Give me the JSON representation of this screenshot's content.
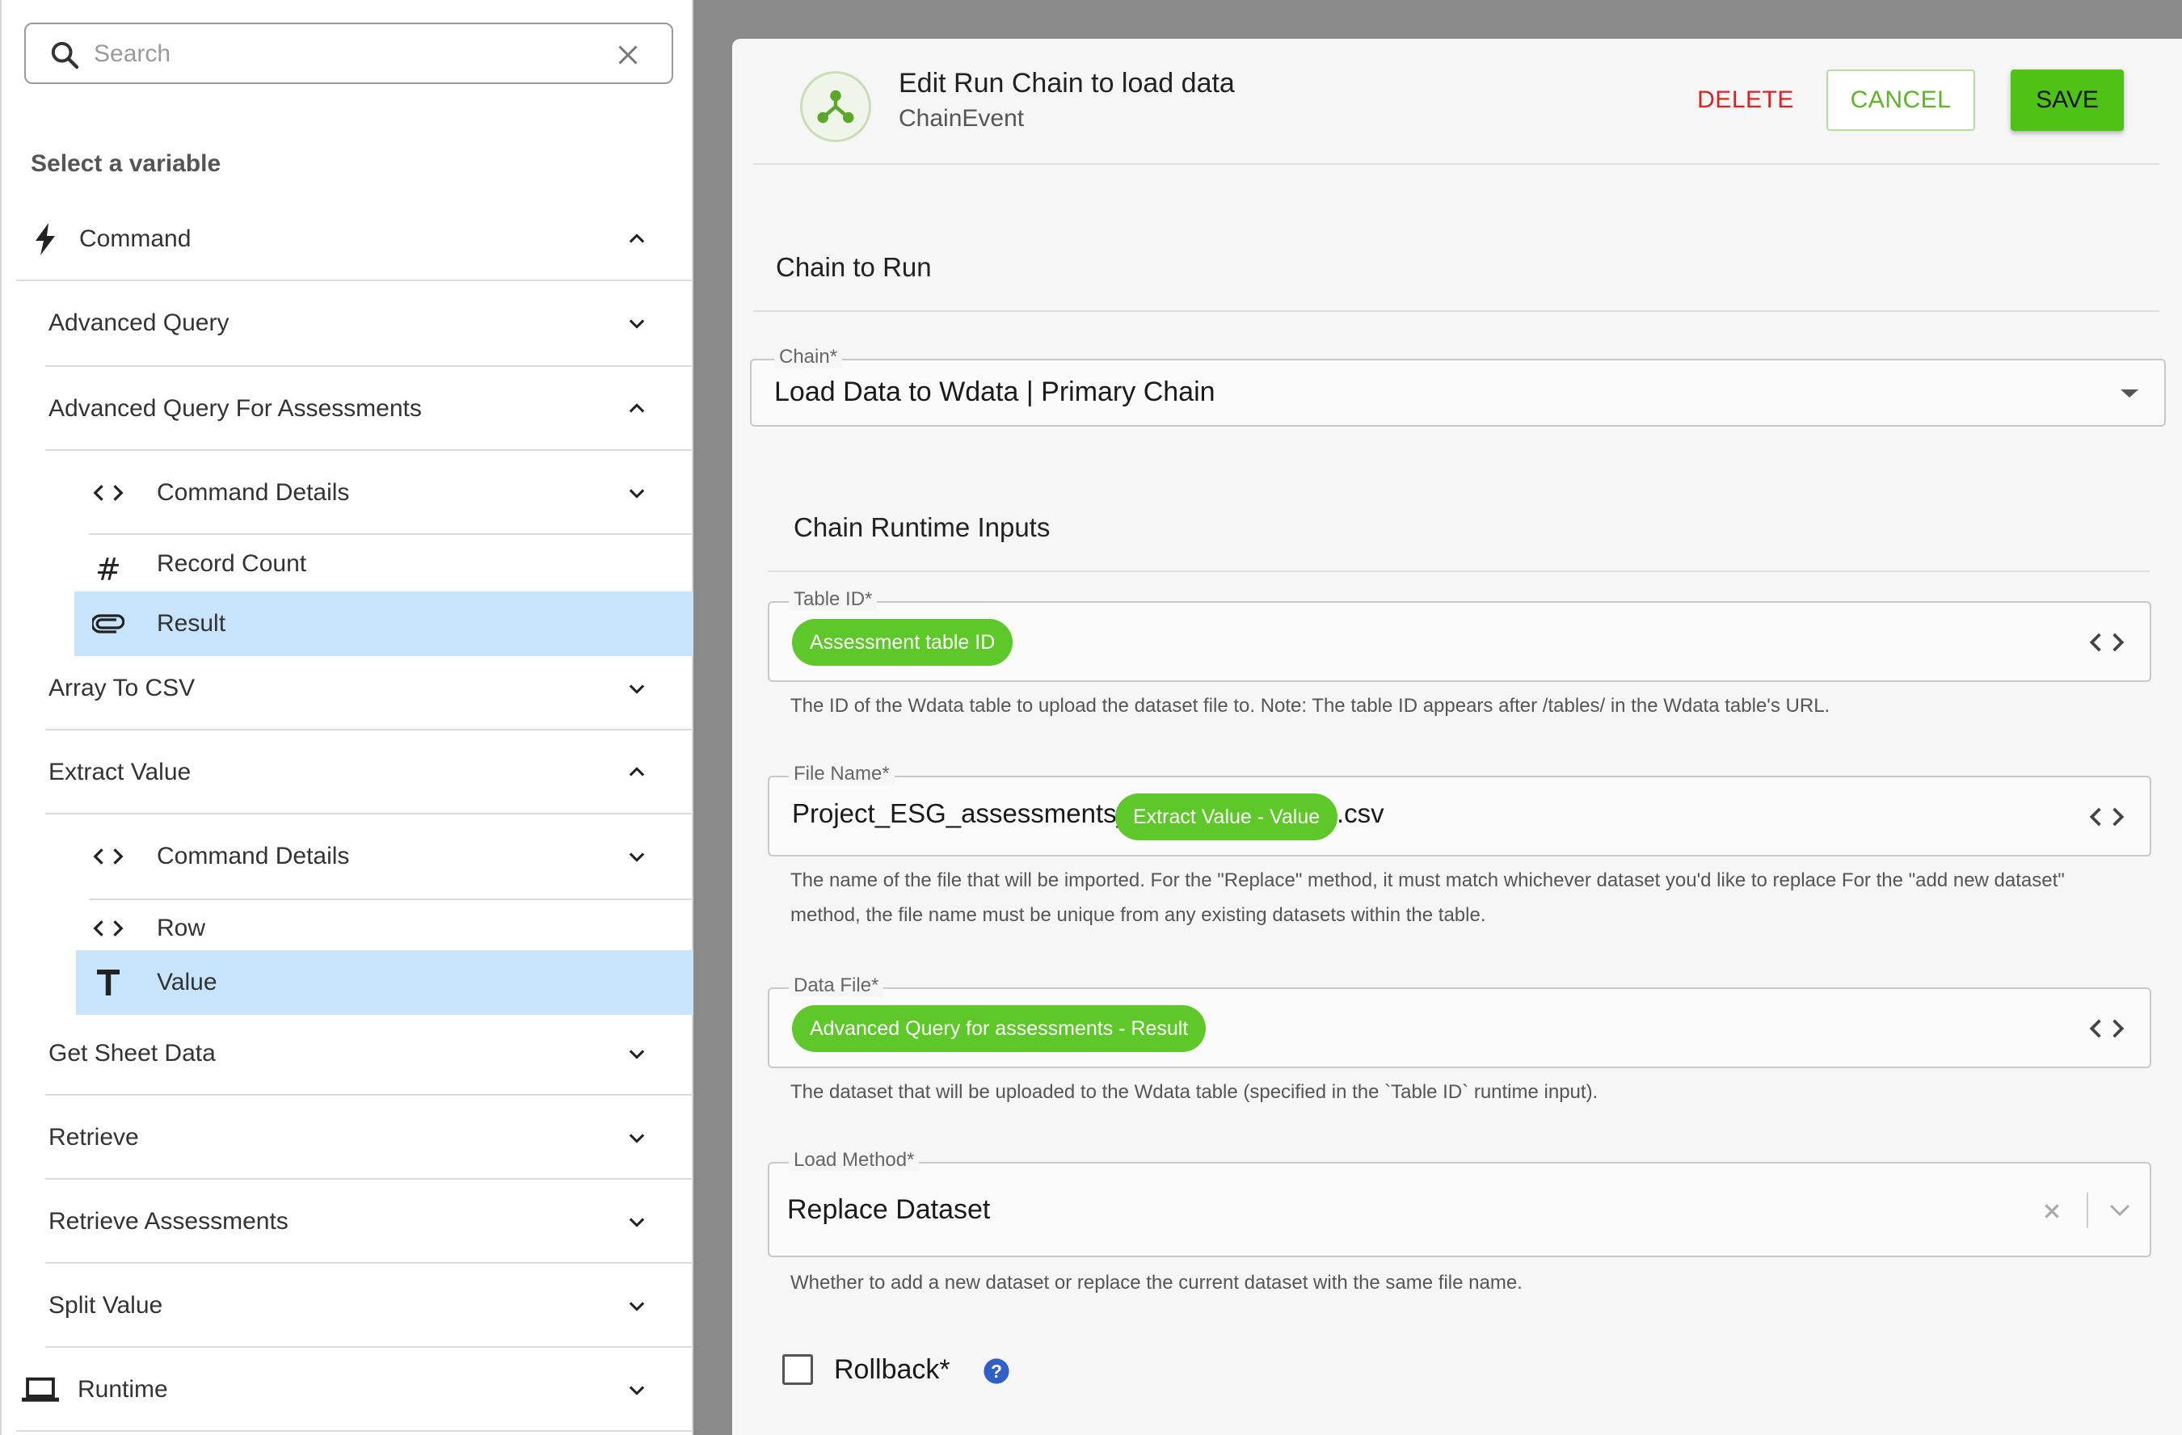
{
  "search": {
    "placeholder": "Search"
  },
  "sidebar": {
    "title": "Select a variable",
    "items": [
      {
        "label": "Command",
        "expanded": true,
        "icon": "lightning-icon"
      },
      {
        "label": "Advanced Query",
        "expanded": false
      },
      {
        "label": "Advanced Query For Assessments",
        "expanded": true
      },
      {
        "label": "Command Details",
        "icon": "code-icon",
        "expanded": false
      },
      {
        "label": "Record Count",
        "icon": "hash-icon"
      },
      {
        "label": "Result",
        "icon": "paperclip-icon",
        "selected": true
      },
      {
        "label": "Array To CSV",
        "expanded": false
      },
      {
        "label": "Extract Value",
        "expanded": true
      },
      {
        "label": "Command Details",
        "icon": "code-icon",
        "expanded": false
      },
      {
        "label": "Row",
        "icon": "code-icon"
      },
      {
        "label": "Value",
        "icon": "text-icon",
        "selected": true
      },
      {
        "label": "Get Sheet Data",
        "expanded": false
      },
      {
        "label": "Retrieve",
        "expanded": false
      },
      {
        "label": "Retrieve Assessments",
        "expanded": false
      },
      {
        "label": "Split Value",
        "expanded": false
      },
      {
        "label": "Runtime",
        "icon": "laptop-icon",
        "expanded": false
      }
    ]
  },
  "dialog": {
    "title": "Edit Run Chain to load data",
    "subtitle": "ChainEvent",
    "delete_label": "DELETE",
    "cancel_label": "CANCEL",
    "save_label": "SAVE",
    "section_chain": "Chain to Run",
    "chain_field": {
      "label": "Chain*",
      "value": "Load Data to Wdata | Primary Chain"
    },
    "section_inputs": "Chain Runtime Inputs",
    "table_id": {
      "label": "Table ID*",
      "chip": "Assessment table ID",
      "helper": "The ID of the Wdata table to upload the dataset file to. Note: The table ID appears after /tables/ in the Wdata table's URL."
    },
    "file_name": {
      "label": "File Name*",
      "prefix": "Project_ESG_assessments_",
      "chip": "Extract Value - Value",
      "suffix": ".csv",
      "helper_line1": "The name of the file that will be imported. For the \"Replace\" method, it must match whichever dataset you'd like to replace For the \"add new dataset\"",
      "helper_line2": "method, the file name must be unique from any existing datasets within the table."
    },
    "data_file": {
      "label": "Data File*",
      "chip": "Advanced Query for assessments - Result",
      "helper": "The dataset that will be uploaded to the Wdata table (specified in the `Table ID` runtime input)."
    },
    "load_method": {
      "label": "Load Method*",
      "value": "Replace Dataset",
      "helper": "Whether to add a new dataset or replace the current dataset with the same file name."
    },
    "rollback": {
      "label": "Rollback*",
      "checked": false
    }
  },
  "colors": {
    "accent_green": "#5ec72a",
    "save_green": "#4ec315",
    "delete_red": "#e02020",
    "selected_row": "#c8e4fa",
    "help_blue": "#2f5fc7"
  }
}
